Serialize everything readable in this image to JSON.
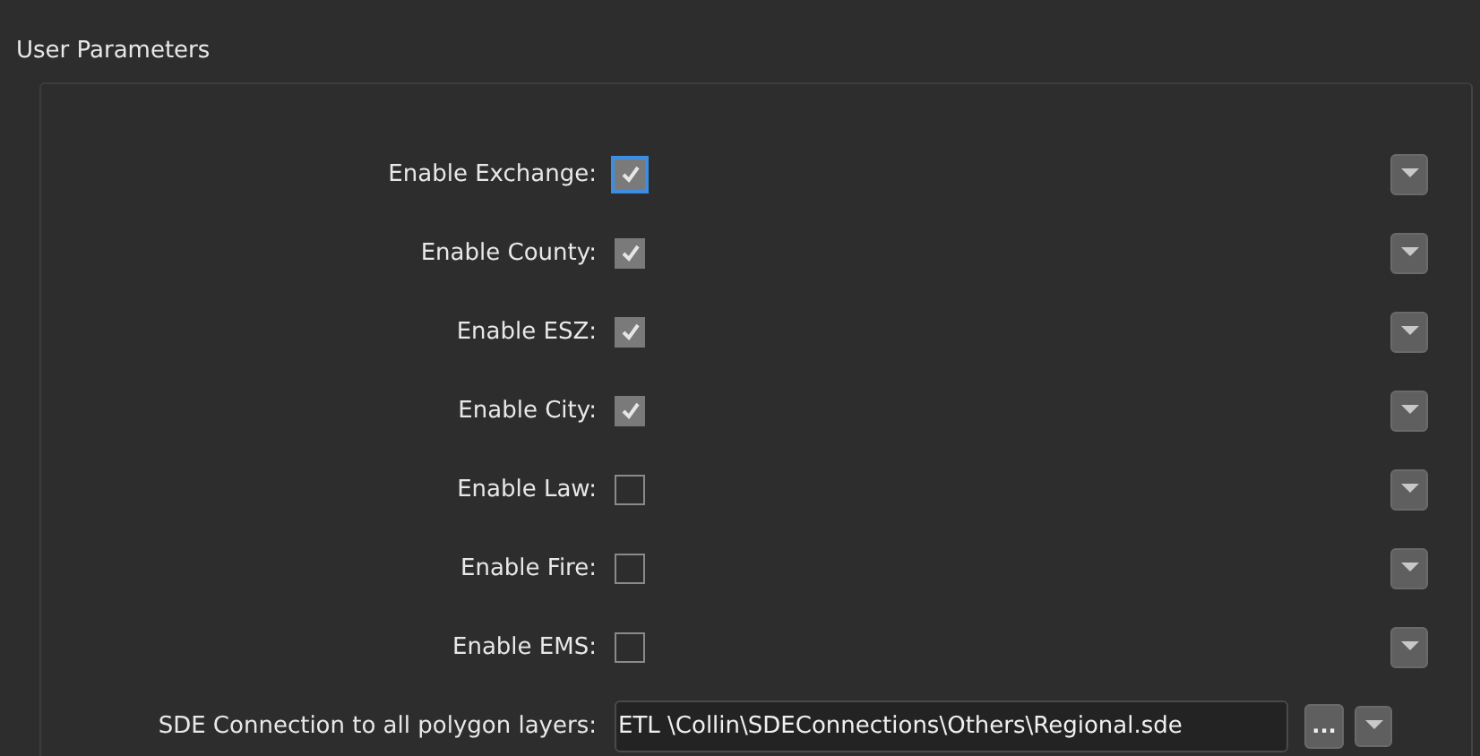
{
  "section": {
    "title": "User Parameters"
  },
  "parameters": [
    {
      "kind": "checkbox",
      "label": "Enable Exchange:",
      "checked": true,
      "focused": true
    },
    {
      "kind": "checkbox",
      "label": "Enable County:",
      "checked": true
    },
    {
      "kind": "checkbox",
      "label": "Enable ESZ:",
      "checked": true
    },
    {
      "kind": "checkbox",
      "label": "Enable City:",
      "checked": true
    },
    {
      "kind": "checkbox",
      "label": "Enable Law:",
      "checked": false
    },
    {
      "kind": "checkbox",
      "label": "Enable Fire:",
      "checked": false
    },
    {
      "kind": "checkbox",
      "label": "Enable EMS:",
      "checked": false
    },
    {
      "kind": "path",
      "label": "SDE Connection to all polygon layers:",
      "value": "ETL \\Collin\\SDEConnections\\Others\\Regional.sde",
      "browse": "..."
    }
  ]
}
